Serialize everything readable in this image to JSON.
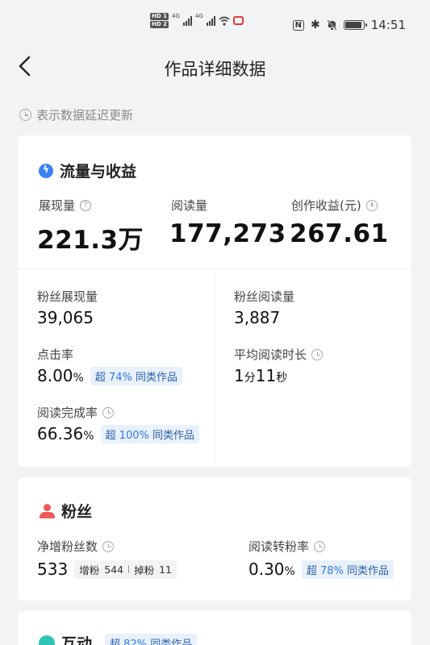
{
  "status_bar": {
    "hd1": "HD 1",
    "hd2": "HD 2",
    "net1": "4G",
    "net2": "4G",
    "nfc": "N",
    "time": "14:51"
  },
  "nav": {
    "title": "作品详细数据"
  },
  "notice": {
    "text": "表示数据延迟更新"
  },
  "traffic": {
    "title": "流量与收益",
    "impressions_label": "展现量",
    "impressions_value": "221.3万",
    "reads_label": "阅读量",
    "reads_value": "177,273",
    "earnings_label": "创作收益(元)",
    "earnings_value": "267.61",
    "fan_impressions_label": "粉丝展现量",
    "fan_impressions_value": "39,065",
    "fan_reads_label": "粉丝阅读量",
    "fan_reads_value": "3,887",
    "ctr_label": "点击率",
    "ctr_value": "8.00",
    "ctr_unit": "%",
    "ctr_badge_prefix": "超",
    "ctr_badge_pct": "74%",
    "ctr_badge_suffix": "同类作品",
    "avg_time_label": "平均阅读时长",
    "avg_time_min": "1",
    "avg_time_min_unit": "分",
    "avg_time_sec": "11",
    "avg_time_sec_unit": "秒",
    "completion_label": "阅读完成率",
    "completion_value": "66.36",
    "completion_unit": "%",
    "completion_badge_prefix": "超",
    "completion_badge_pct": "100%",
    "completion_badge_suffix": "同类作品"
  },
  "fans": {
    "title": "粉丝",
    "net_label": "净增粉丝数",
    "net_value": "533",
    "gain_label": "增粉",
    "gain_value": "544",
    "loss_label": "掉粉",
    "loss_value": "11",
    "conv_label": "阅读转粉率",
    "conv_value": "0.30",
    "conv_unit": "%",
    "conv_badge_prefix": "超",
    "conv_badge_pct": "78%",
    "conv_badge_suffix": "同类作品"
  },
  "interaction": {
    "title": "互动",
    "badge_prefix": "超",
    "badge_pct": "82%",
    "badge_suffix": "同类作品"
  },
  "colors": {
    "accent_blue": "#2f7be0",
    "fans_red": "#f25a5a",
    "interaction_teal": "#2ec4b6"
  }
}
